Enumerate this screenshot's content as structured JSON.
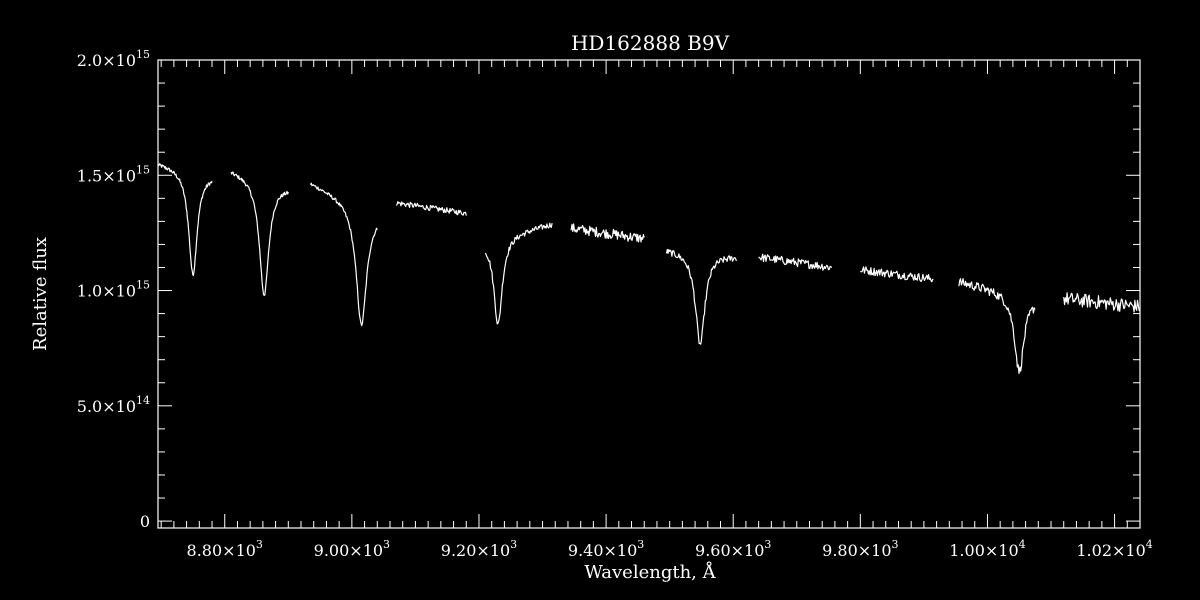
{
  "chart_data": {
    "type": "line",
    "title": "HD162888   B9V",
    "xlabel": "Wavelength, Å",
    "ylabel": "Relative flux",
    "xlim": [
      8695,
      10240
    ],
    "ylim": [
      -30000000000000,
      2000000000000000
    ],
    "x_ticks": [
      {
        "value": 8800,
        "label": "8.80×10",
        "exp": "3"
      },
      {
        "value": 9000,
        "label": "9.00×10",
        "exp": "3"
      },
      {
        "value": 9200,
        "label": "9.20×10",
        "exp": "3"
      },
      {
        "value": 9400,
        "label": "9.40×10",
        "exp": "3"
      },
      {
        "value": 9600,
        "label": "9.60×10",
        "exp": "3"
      },
      {
        "value": 9800,
        "label": "9.80×10",
        "exp": "3"
      },
      {
        "value": 10000,
        "label": "1.00×10",
        "exp": "4"
      },
      {
        "value": 10200,
        "label": "1.02×10",
        "exp": "4"
      }
    ],
    "y_ticks": [
      {
        "value": 0,
        "label": "0",
        "exp": ""
      },
      {
        "value": 500000000000000,
        "label": "5.0×10",
        "exp": "14"
      },
      {
        "value": 1000000000000000,
        "label": "1.0×10",
        "exp": "15"
      },
      {
        "value": 1500000000000000,
        "label": "1.5×10",
        "exp": "15"
      },
      {
        "value": 2000000000000000,
        "label": "2.0×10",
        "exp": "15"
      }
    ],
    "grid": false,
    "colors": {
      "background": "#000000",
      "foreground": "#ffffff"
    },
    "segments": [
      {
        "kind": "absorption",
        "x_start": 8695,
        "x_end": 8780,
        "y_start": 1555000000000000.0,
        "y_end": 1500000000000000.0,
        "line_center": 8750,
        "line_depth": 450000000000000.0,
        "line_width": 8,
        "noise": 8000000000000.0
      },
      {
        "kind": "absorption",
        "x_start": 8810,
        "x_end": 8900,
        "y_start": 1525000000000000.0,
        "y_end": 1450000000000000.0,
        "line_center": 8862,
        "line_depth": 500000000000000.0,
        "line_width": 9,
        "noise": 8000000000000.0
      },
      {
        "kind": "absorption",
        "x_start": 8935,
        "x_end": 9040,
        "y_start": 1470000000000000.0,
        "y_end": 1340000000000000.0,
        "line_center": 9015,
        "line_depth": 520000000000000.0,
        "line_width": 10,
        "noise": 8000000000000.0
      },
      {
        "kind": "continuum",
        "x_start": 9070,
        "x_end": 9180,
        "y_start": 1380000000000000.0,
        "y_end": 1335000000000000.0,
        "noise": 12000000000000.0
      },
      {
        "kind": "absorption",
        "x_start": 9210,
        "x_end": 9315,
        "y_start": 1220000000000000.0,
        "y_end": 1290000000000000.0,
        "line_center": 9230,
        "line_depth": 380000000000000.0,
        "line_width": 8,
        "noise": 12000000000000.0
      },
      {
        "kind": "continuum",
        "x_start": 9345,
        "x_end": 9460,
        "y_start": 1270000000000000.0,
        "y_end": 1225000000000000.0,
        "noise": 22000000000000.0
      },
      {
        "kind": "absorption",
        "x_start": 9495,
        "x_end": 9605,
        "y_start": 1180000000000000.0,
        "y_end": 1150000000000000.0,
        "line_center": 9548,
        "line_depth": 400000000000000.0,
        "line_width": 9,
        "noise": 14000000000000.0
      },
      {
        "kind": "continuum",
        "x_start": 9640,
        "x_end": 9755,
        "y_start": 1145000000000000.0,
        "y_end": 1100000000000000.0,
        "noise": 18000000000000.0
      },
      {
        "kind": "continuum",
        "x_start": 9800,
        "x_end": 9915,
        "y_start": 1090000000000000.0,
        "y_end": 1050000000000000.0,
        "noise": 18000000000000.0
      },
      {
        "kind": "absorption",
        "x_start": 9955,
        "x_end": 10075,
        "y_start": 1040000000000000.0,
        "y_end": 965000000000000.0,
        "line_center": 10050,
        "line_depth": 330000000000000.0,
        "line_width": 9,
        "noise": 20000000000000.0
      },
      {
        "kind": "continuum",
        "x_start": 10120,
        "x_end": 10240,
        "y_start": 965000000000000.0,
        "y_end": 930000000000000.0,
        "noise": 30000000000000.0
      }
    ]
  }
}
